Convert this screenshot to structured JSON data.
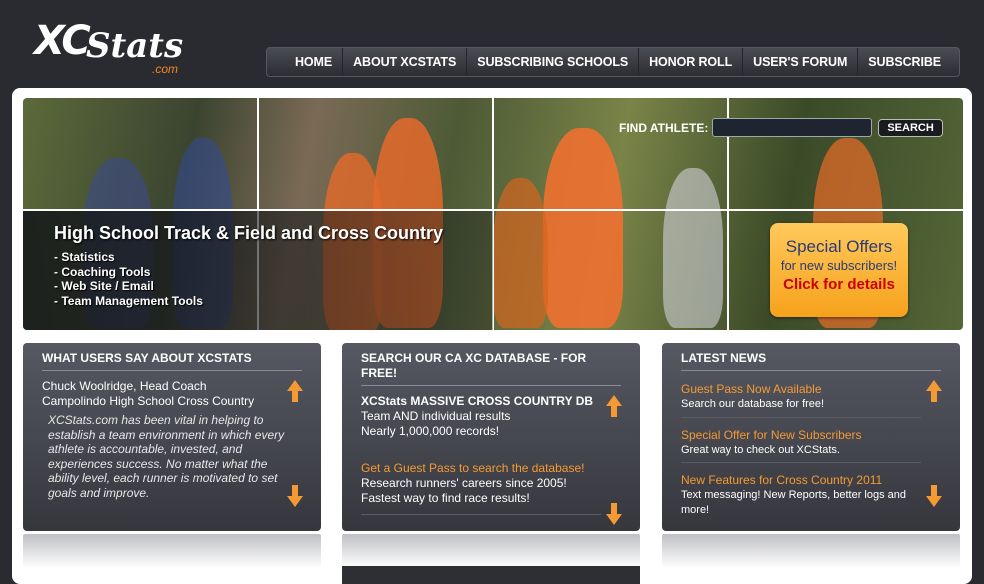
{
  "logo": {
    "xc": "XC",
    "stats": "Stats",
    "com": ".com"
  },
  "nav": [
    "HOME",
    "ABOUT XCSTATS",
    "SUBSCRIBING SCHOOLS",
    "HONOR ROLL",
    "USER'S FORUM",
    "SUBSCRIBE"
  ],
  "search": {
    "label": "FIND ATHLETE:",
    "button": "SEARCH",
    "placeholder": ""
  },
  "banner": {
    "title": "High School Track & Field and Cross Country",
    "items": [
      "- Statistics",
      "- Coaching Tools",
      "- Web Site / Email",
      "- Team Management Tools"
    ]
  },
  "offer": {
    "line1": "Special Offers",
    "line2": "for new subscribers!",
    "line3": "Click for details"
  },
  "testimonials": {
    "heading": "WHAT USERS SAY ABOUT XCSTATS",
    "name": "Chuck Woolridge, Head Coach",
    "school": "Campolindo High School Cross Country",
    "quote": "XCStats.com has been vital in helping to establish a team environment in which every athlete is accountable, invested, and experiences success. No matter what the ability level, each runner is motivated to set goals and improve."
  },
  "database": {
    "heading": "SEARCH OUR CA XC DATABASE - FOR FREE!",
    "title": "XCStats MASSIVE CROSS COUNTRY DB",
    "line1": "Team AND individual results",
    "line2": "Nearly 1,000,000 records!",
    "link": "Get a Guest Pass to search the database!",
    "line3": "Research runners' careers since 2005!",
    "line4": "Fastest way to find race results!"
  },
  "news": {
    "heading": "LATEST NEWS",
    "items": [
      {
        "title": "Guest Pass Now Available",
        "desc": "Search our database for free!"
      },
      {
        "title": "Special Offer for New Subscribers",
        "desc": "Great way to check out XCStats."
      },
      {
        "title": "New Features for Cross Country 2011",
        "desc": "Text messaging! New Reports, better logs and more!"
      }
    ]
  },
  "colors": {
    "accent": "#f59a33",
    "background": "#2a2b30",
    "offer": "#f6a21c"
  }
}
